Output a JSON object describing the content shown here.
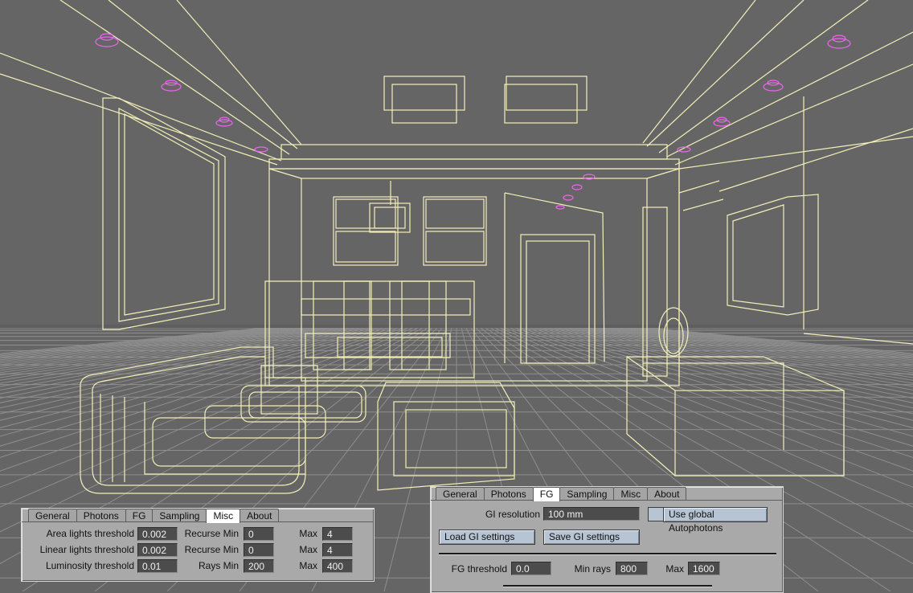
{
  "panel_left": {
    "tabs": [
      "General",
      "Photons",
      "FG",
      "Sampling",
      "Misc",
      "About"
    ],
    "active_tab": "Misc",
    "rows": [
      {
        "label": "Area lights threshold",
        "value": "0.002",
        "mid_label": "Recurse Min",
        "mid_value": "0",
        "max_label": "Max",
        "max_value": "4"
      },
      {
        "label": "Linear lights threshold",
        "value": "0.002",
        "mid_label": "Recurse Min",
        "mid_value": "0",
        "max_label": "Max",
        "max_value": "4"
      },
      {
        "label": "Luminosity threshold",
        "value": "0.01",
        "mid_label": "Rays Min",
        "mid_value": "200",
        "max_label": "Max",
        "max_value": "400"
      }
    ]
  },
  "panel_right": {
    "tabs": [
      "General",
      "Photons",
      "FG",
      "Sampling",
      "Misc",
      "About"
    ],
    "active_tab": "FG",
    "gi_resolution_label": "GI resolution",
    "gi_resolution_value": "100 mm",
    "use_global_autophotons": "Use global Autophotons",
    "load_gi": "Load GI settings",
    "save_gi": "Save GI settings",
    "fg_threshold_label": "FG threshold",
    "fg_threshold_value": "0.0",
    "min_rays_label": "Min rays",
    "min_rays_value": "800",
    "max_label": "Max",
    "max_value": "1600"
  },
  "colors": {
    "wire": "#f3f0b8",
    "grid": "#9a9a9a",
    "lights": "#ee66ee",
    "background": "#656565"
  }
}
